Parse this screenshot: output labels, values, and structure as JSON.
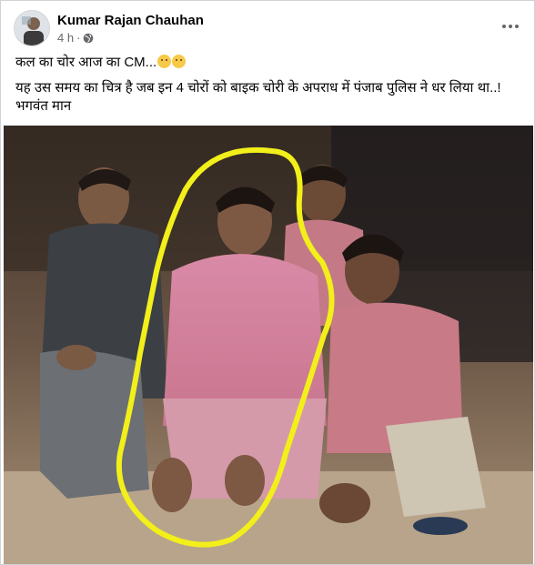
{
  "post": {
    "author": "Kumar Rajan Chauhan",
    "time": "4 h",
    "separator": "·",
    "more_icon": "more-options-icon",
    "privacy_icon": "globe-icon",
    "line1": "कल का चोर आज का CM...",
    "line2": "यह उस समय का चित्र है जब इन 4 चोरों को बाइक चोरी के अपराध में पंजाब पुलिस ने धर लिया था..!भगवंत मान",
    "emojis": [
      "sad-face-emoji",
      "sad-face-emoji"
    ]
  },
  "photo": {
    "description_icon": "group-photo",
    "highlight_color": "#f2ef1a"
  }
}
